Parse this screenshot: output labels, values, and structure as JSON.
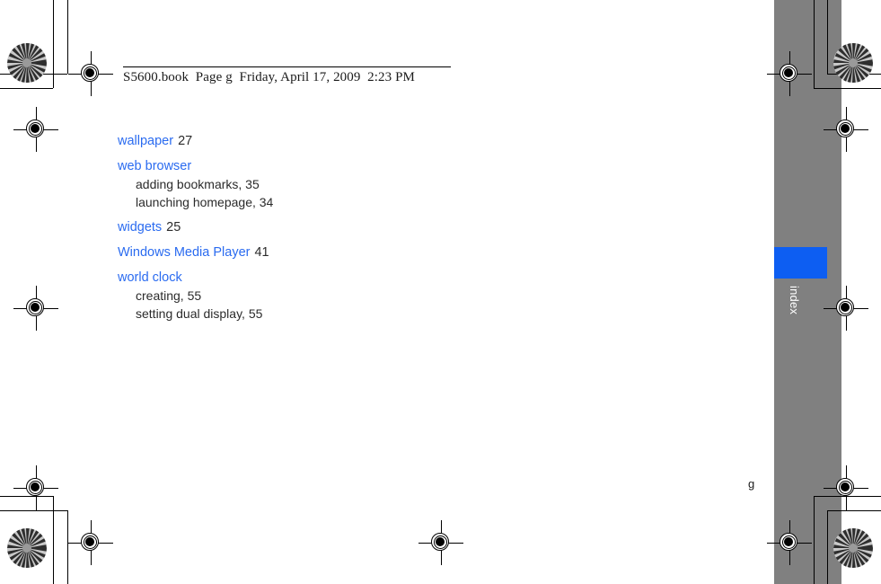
{
  "header": {
    "filename": "S5600.book",
    "page_label": "Page g",
    "date": "Friday, April 17, 2009",
    "time": "2:23 PM",
    "full_line": "S5600.book  Page g  Friday, April 17, 2009  2:23 PM"
  },
  "side_tab": {
    "label": "index",
    "tab_color": "#0d5ef2",
    "band_color": "#808080",
    "label_color": "#ffffff"
  },
  "folio": {
    "page_number": "g"
  },
  "colors": {
    "term_link": "#2a6bf0",
    "body_text": "#2b2b2b",
    "band_gray": "#808080",
    "tab_blue": "#0d5ef2"
  },
  "index": {
    "entries": [
      {
        "term": "wallpaper",
        "page": "27",
        "subentries": []
      },
      {
        "term": "web browser",
        "page": "",
        "subentries": [
          "adding bookmarks,  35",
          "launching homepage,  34"
        ]
      },
      {
        "term": "widgets",
        "page": "25",
        "subentries": []
      },
      {
        "term": "Windows Media Player",
        "page": "41",
        "subentries": []
      },
      {
        "term": "world clock",
        "page": "",
        "subentries": [
          "creating,  55",
          "setting dual display,  55"
        ]
      }
    ]
  },
  "print_marks": {
    "registration_icon": "registration-crosshair",
    "star_target_icon": "star-target",
    "crop_line_icon": "crop-line"
  }
}
